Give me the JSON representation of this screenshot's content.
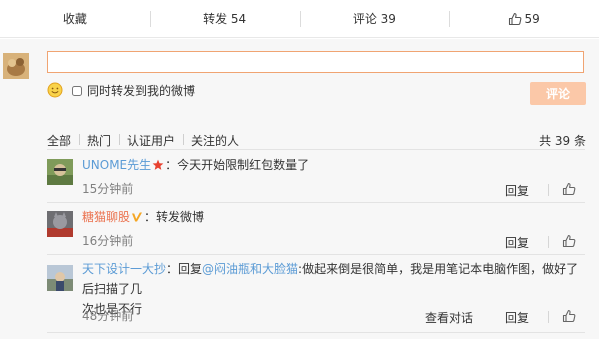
{
  "actions": {
    "favorite": "收藏",
    "repost": "转发 54",
    "comment": "评论 39",
    "like_count": "59"
  },
  "composer": {
    "input_value": "",
    "forward_checkbox_label": "同时转发到我的微博",
    "submit_label": "评论"
  },
  "filters": {
    "tabs": [
      "全部",
      "热门",
      "认证用户",
      "关注的人"
    ],
    "total": "共 39 条"
  },
  "comments": [
    {
      "user": "UNOME先生",
      "text": "：今天开始限制红包数量了",
      "time": "15分钟前",
      "reply_label": "回复"
    },
    {
      "user": "糖猫聊股",
      "text": "：转发微博",
      "time": "16分钟前",
      "reply_label": "回复"
    },
    {
      "user": "天下设计一大抄",
      "text_prefix": "：回复",
      "mention": "@闷油瓶和大脸猫",
      "text_line1": ":做起来倒是很简单，我是用笔记本电脑作图，做好了后扫描了几",
      "text_line2": "次也是不行",
      "time": "48分钟前",
      "dialog_label": "查看对话",
      "reply_label": "回复"
    }
  ],
  "colors": {
    "accent": "#eb7350",
    "link_blue": "#5b9bd5",
    "submit_disabled": "#fbc8a8",
    "input_border": "#f0a472"
  }
}
